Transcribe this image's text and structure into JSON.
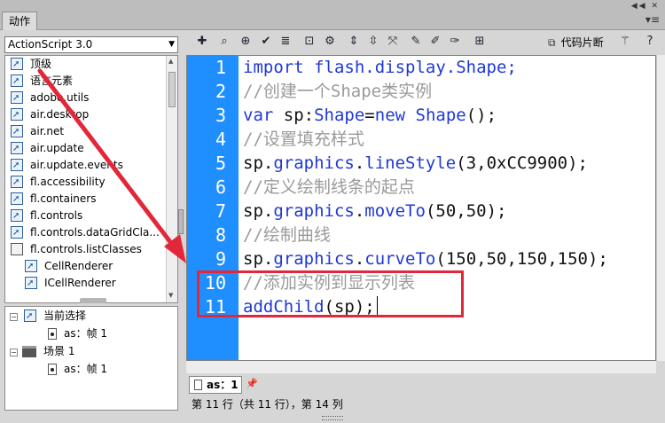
{
  "window": {
    "tab_label": "动作",
    "tab_menu_icon": "menu-lines-icon",
    "top_controls": "collapse-close-icons"
  },
  "left_panel": {
    "language_select": "ActionScript 3.0",
    "tree_items": [
      {
        "label": "顶级",
        "icon": "book-icon",
        "indent": false
      },
      {
        "label": "语言元素",
        "icon": "book-icon",
        "indent": false
      },
      {
        "label": "adobe.utils",
        "icon": "book-icon",
        "indent": false
      },
      {
        "label": "air.desktop",
        "icon": "book-icon",
        "indent": false
      },
      {
        "label": "air.net",
        "icon": "book-icon",
        "indent": false
      },
      {
        "label": "air.update",
        "icon": "book-icon",
        "indent": false
      },
      {
        "label": "air.update.events",
        "icon": "book-icon",
        "indent": false
      },
      {
        "label": "fl.accessibility",
        "icon": "book-icon",
        "indent": false
      },
      {
        "label": "fl.containers",
        "icon": "book-icon",
        "indent": false
      },
      {
        "label": "fl.controls",
        "icon": "book-icon",
        "indent": false
      },
      {
        "label": "fl.controls.dataGridCla...",
        "icon": "book-icon",
        "indent": false
      },
      {
        "label": "fl.controls.listClasses",
        "icon": "class-doc-icon",
        "indent": false
      },
      {
        "label": "CellRenderer",
        "icon": "book-icon",
        "indent": true
      },
      {
        "label": "ICellRenderer",
        "icon": "book-icon",
        "indent": true
      }
    ],
    "scene_tree": {
      "current_selection": "当前选择",
      "current_frame": "as：帧 1",
      "scene_label": "场景 1",
      "scene_frame": "as：帧 1"
    }
  },
  "toolbar": {
    "icons": [
      "add-item-icon",
      "find-icon",
      "target-icon",
      "check-syntax-icon",
      "auto-format-icon",
      "code-hint-icon",
      "debug-options-icon",
      "collapse-between-braces-icon",
      "collapse-selection-icon",
      "expand-all-icon",
      "apply-block-comment-icon",
      "apply-line-comment-icon",
      "remove-comment-icon",
      "show-hide-toolbox-icon"
    ],
    "snippets_label": "代码片断",
    "wand_icon": "magic-wand-icon",
    "help_icon": "help-icon"
  },
  "editor": {
    "lines": [
      {
        "num": "1",
        "kind": "code",
        "parts": [
          {
            "t": "import flash.display.Shape;",
            "c": "kw"
          }
        ]
      },
      {
        "num": "2",
        "kind": "comment",
        "parts": [
          {
            "t": "//创建一个Shape类实例",
            "c": "cm"
          }
        ]
      },
      {
        "num": "3",
        "kind": "code",
        "parts": [
          {
            "t": "var",
            "c": "kw"
          },
          {
            "t": " sp:",
            "c": ""
          },
          {
            "t": "Shape",
            "c": "kw"
          },
          {
            "t": "=",
            "c": ""
          },
          {
            "t": "new",
            "c": "kw"
          },
          {
            "t": " ",
            "c": ""
          },
          {
            "t": "Shape",
            "c": "kw"
          },
          {
            "t": "();",
            "c": ""
          }
        ]
      },
      {
        "num": "4",
        "kind": "comment",
        "parts": [
          {
            "t": "//设置填充样式",
            "c": "cm"
          }
        ]
      },
      {
        "num": "5",
        "kind": "code",
        "parts": [
          {
            "t": "sp.",
            "c": ""
          },
          {
            "t": "graphics",
            "c": "kw"
          },
          {
            "t": ".",
            "c": ""
          },
          {
            "t": "lineStyle",
            "c": "kw"
          },
          {
            "t": "(3,0xCC9900);",
            "c": ""
          }
        ]
      },
      {
        "num": "6",
        "kind": "comment",
        "parts": [
          {
            "t": "//定义绘制线条的起点",
            "c": "cm"
          }
        ]
      },
      {
        "num": "7",
        "kind": "code",
        "parts": [
          {
            "t": "sp.",
            "c": ""
          },
          {
            "t": "graphics",
            "c": "kw"
          },
          {
            "t": ".",
            "c": ""
          },
          {
            "t": "moveTo",
            "c": "kw"
          },
          {
            "t": "(50,50);",
            "c": ""
          }
        ]
      },
      {
        "num": "8",
        "kind": "comment",
        "parts": [
          {
            "t": "//绘制曲线",
            "c": "cm"
          }
        ]
      },
      {
        "num": "9",
        "kind": "code",
        "parts": [
          {
            "t": "sp.",
            "c": ""
          },
          {
            "t": "graphics",
            "c": "kw"
          },
          {
            "t": ".",
            "c": ""
          },
          {
            "t": "curveTo",
            "c": "kw"
          },
          {
            "t": "(150,50,150,150);",
            "c": ""
          }
        ]
      },
      {
        "num": "10",
        "kind": "comment",
        "parts": [
          {
            "t": "//添加实例到显示列表",
            "c": "cm"
          }
        ]
      },
      {
        "num": "11",
        "kind": "code",
        "parts": [
          {
            "t": "addChild",
            "c": "kw"
          },
          {
            "t": "(sp);",
            "c": ""
          }
        ]
      }
    ],
    "highlighted_lines": [
      "10",
      "11"
    ],
    "gutter_color": "#1f8fff",
    "highlight_color": "#e3273a"
  },
  "bottom": {
    "file_tab": "as：1",
    "pin_icon": "pin-icon",
    "status": "第 11 行（共 11 行），第 14 列"
  }
}
